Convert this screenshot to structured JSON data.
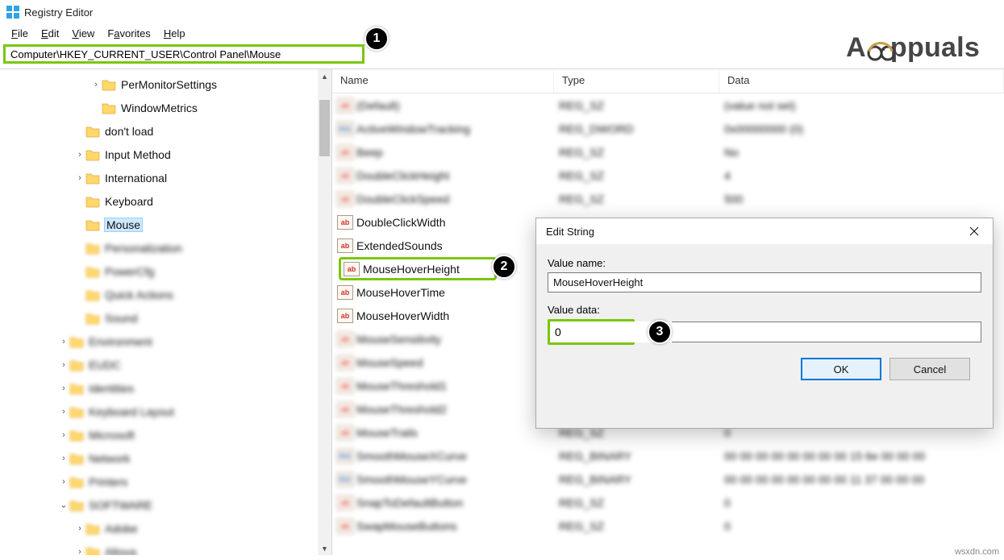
{
  "titlebar": {
    "title": "Registry Editor"
  },
  "menu": {
    "file": "File",
    "edit": "Edit",
    "view": "View",
    "favorites": "Favorites",
    "help": "Help"
  },
  "addressbar": {
    "value": "Computer\\HKEY_CURRENT_USER\\Control Panel\\Mouse"
  },
  "badges": {
    "b1": "1",
    "b2": "2",
    "b3": "3"
  },
  "tree": {
    "items": [
      {
        "indent": 112,
        "twisty": ">",
        "label": "PerMonitorSettings",
        "blur": false
      },
      {
        "indent": 112,
        "twisty": "",
        "label": "WindowMetrics",
        "blur": false
      },
      {
        "indent": 92,
        "twisty": "",
        "label": "don't load",
        "blur": false
      },
      {
        "indent": 92,
        "twisty": ">",
        "label": "Input Method",
        "blur": false
      },
      {
        "indent": 92,
        "twisty": ">",
        "label": "International",
        "blur": false
      },
      {
        "indent": 92,
        "twisty": "",
        "label": "Keyboard",
        "blur": false
      },
      {
        "indent": 92,
        "twisty": "",
        "label": "Mouse",
        "blur": false,
        "selected": true
      },
      {
        "indent": 92,
        "twisty": "",
        "label": "Personalization",
        "blur": true
      },
      {
        "indent": 92,
        "twisty": "",
        "label": "PowerCfg",
        "blur": true
      },
      {
        "indent": 92,
        "twisty": "",
        "label": "Quick Actions",
        "blur": true
      },
      {
        "indent": 92,
        "twisty": "",
        "label": "Sound",
        "blur": true
      },
      {
        "indent": 72,
        "twisty": ">",
        "label": "Environment",
        "blur": true
      },
      {
        "indent": 72,
        "twisty": ">",
        "label": "EUDC",
        "blur": true
      },
      {
        "indent": 72,
        "twisty": ">",
        "label": "Identities",
        "blur": true
      },
      {
        "indent": 72,
        "twisty": ">",
        "label": "Keyboard Layout",
        "blur": true
      },
      {
        "indent": 72,
        "twisty": ">",
        "label": "Microsoft",
        "blur": true
      },
      {
        "indent": 72,
        "twisty": ">",
        "label": "Network",
        "blur": true
      },
      {
        "indent": 72,
        "twisty": ">",
        "label": "Printers",
        "blur": true
      },
      {
        "indent": 72,
        "twisty": "v",
        "label": "SOFTWARE",
        "blur": true
      },
      {
        "indent": 92,
        "twisty": ">",
        "label": "Adobe",
        "blur": true
      },
      {
        "indent": 92,
        "twisty": ">",
        "label": "Altova",
        "blur": true
      }
    ]
  },
  "list": {
    "headers": {
      "name": "Name",
      "type": "Type",
      "data": "Data"
    },
    "rows": [
      {
        "icon": "ab",
        "name": "(Default)",
        "type": "REG_SZ",
        "data": "(value not set)",
        "blur": true
      },
      {
        "icon": "bin",
        "name": "ActiveWindowTracking",
        "type": "REG_DWORD",
        "data": "0x00000000 (0)",
        "blur": true
      },
      {
        "icon": "ab",
        "name": "Beep",
        "type": "REG_SZ",
        "data": "No",
        "blur": true
      },
      {
        "icon": "ab",
        "name": "DoubleClickHeight",
        "type": "REG_SZ",
        "data": "4",
        "blur": true
      },
      {
        "icon": "ab",
        "name": "DoubleClickSpeed",
        "type": "REG_SZ",
        "data": "500",
        "blur": true
      },
      {
        "icon": "ab",
        "name": "DoubleClickWidth",
        "type": "",
        "data": "",
        "blur": false
      },
      {
        "icon": "ab",
        "name": "ExtendedSounds",
        "type": "",
        "data": "",
        "blur": false
      },
      {
        "icon": "ab",
        "name": "MouseHoverHeight",
        "type": "",
        "data": "",
        "blur": false,
        "highlight": true
      },
      {
        "icon": "ab",
        "name": "MouseHoverTime",
        "type": "",
        "data": "",
        "blur": false
      },
      {
        "icon": "ab",
        "name": "MouseHoverWidth",
        "type": "",
        "data": "",
        "blur": false
      },
      {
        "icon": "ab",
        "name": "MouseSensitivity",
        "type": "",
        "data": "",
        "blur": true
      },
      {
        "icon": "ab",
        "name": "MouseSpeed",
        "type": "",
        "data": "",
        "blur": true
      },
      {
        "icon": "ab",
        "name": "MouseThreshold1",
        "type": "",
        "data": "",
        "blur": true
      },
      {
        "icon": "ab",
        "name": "MouseThreshold2",
        "type": "",
        "data": "",
        "blur": true
      },
      {
        "icon": "ab",
        "name": "MouseTrails",
        "type": "REG_SZ",
        "data": "0",
        "blur": true
      },
      {
        "icon": "bin",
        "name": "SmoothMouseXCurve",
        "type": "REG_BINARY",
        "data": "00 00 00 00 00 00 00 00 15 6e 00 00 00",
        "blur": true
      },
      {
        "icon": "bin",
        "name": "SmoothMouseYCurve",
        "type": "REG_BINARY",
        "data": "00 00 00 00 00 00 00 00 11 37 00 00 00",
        "blur": true
      },
      {
        "icon": "ab",
        "name": "SnapToDefaultButton",
        "type": "REG_SZ",
        "data": "0",
        "blur": true
      },
      {
        "icon": "ab",
        "name": "SwapMouseButtons",
        "type": "REG_SZ",
        "data": "0",
        "blur": true
      }
    ]
  },
  "dialog": {
    "title": "Edit String",
    "valuename_label": "Value name:",
    "valuename": "MouseHoverHeight",
    "valuedata_label": "Value data:",
    "valuedata": "0",
    "ok": "OK",
    "cancel": "Cancel"
  },
  "watermark": {
    "text_left": "A",
    "text_right": "ppuals"
  },
  "footer": {
    "text": "wsxdn.com"
  }
}
